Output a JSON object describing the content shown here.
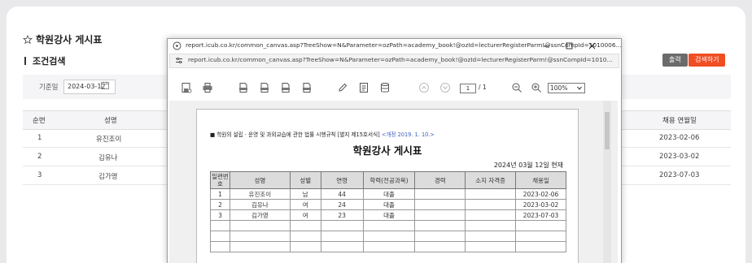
{
  "page": {
    "title": "학원강사 게시표"
  },
  "search_section": {
    "title": "조건검색",
    "print_label": "출력",
    "search_label": "검색하기"
  },
  "filter": {
    "label": "기준일",
    "date_value": "2024-03-12"
  },
  "grid": {
    "headers": {
      "no": "순번",
      "name": "성명",
      "date": "채용 연월일"
    },
    "rows": [
      {
        "no": "1",
        "name": "유진조이",
        "date": "2023-02-06"
      },
      {
        "no": "2",
        "name": "김유나",
        "date": "2023-03-02"
      },
      {
        "no": "3",
        "name": "김가영",
        "date": "2023-07-03"
      }
    ]
  },
  "popup": {
    "title_url": "report.icub.co.kr/common_canvas.asp?TreeShow=N&Parameter=ozPath=academy_book!@ozId=lecturerRegisterParm!@ssnCompId=1010006...",
    "address_url": "report.icub.co.kr/common_canvas.asp?TreeShow=N&Parameter=ozPath=academy_book!@ozId=lecturerRegisterParm!@ssnCompId=1010...",
    "page_current": "1",
    "page_total": "/ 1",
    "zoom": "100%"
  },
  "report": {
    "note": "■ 학원의 설립 · 운영 및 과외교습에 관한 법률 시행규칙 [별지 제15호서식]",
    "note_revision": "<개정 2019. 1. 10.>",
    "title": "학원강사 게시표",
    "date_line": "2024년 03월 12일 현재",
    "headers": {
      "no": "일련번호",
      "name": "성명",
      "gender": "성별",
      "age": "연령",
      "education": "학력(전공과목)",
      "career": "경력",
      "license": "소지 자격증",
      "hire_date": "채용일"
    },
    "rows": [
      {
        "no": "1",
        "name": "유진조이",
        "gender": "남",
        "age": "44",
        "education": "대졸",
        "career": "",
        "license": "",
        "hire_date": "2023-02-06"
      },
      {
        "no": "2",
        "name": "김유나",
        "gender": "여",
        "age": "24",
        "education": "대졸",
        "career": "",
        "license": "",
        "hire_date": "2023-03-02"
      },
      {
        "no": "3",
        "name": "김가영",
        "gender": "여",
        "age": "23",
        "education": "대졸",
        "career": "",
        "license": "",
        "hire_date": "2023-07-03"
      }
    ]
  },
  "colors": {
    "accent": "#f04e23",
    "secondary_button": "#6b6b6b"
  }
}
